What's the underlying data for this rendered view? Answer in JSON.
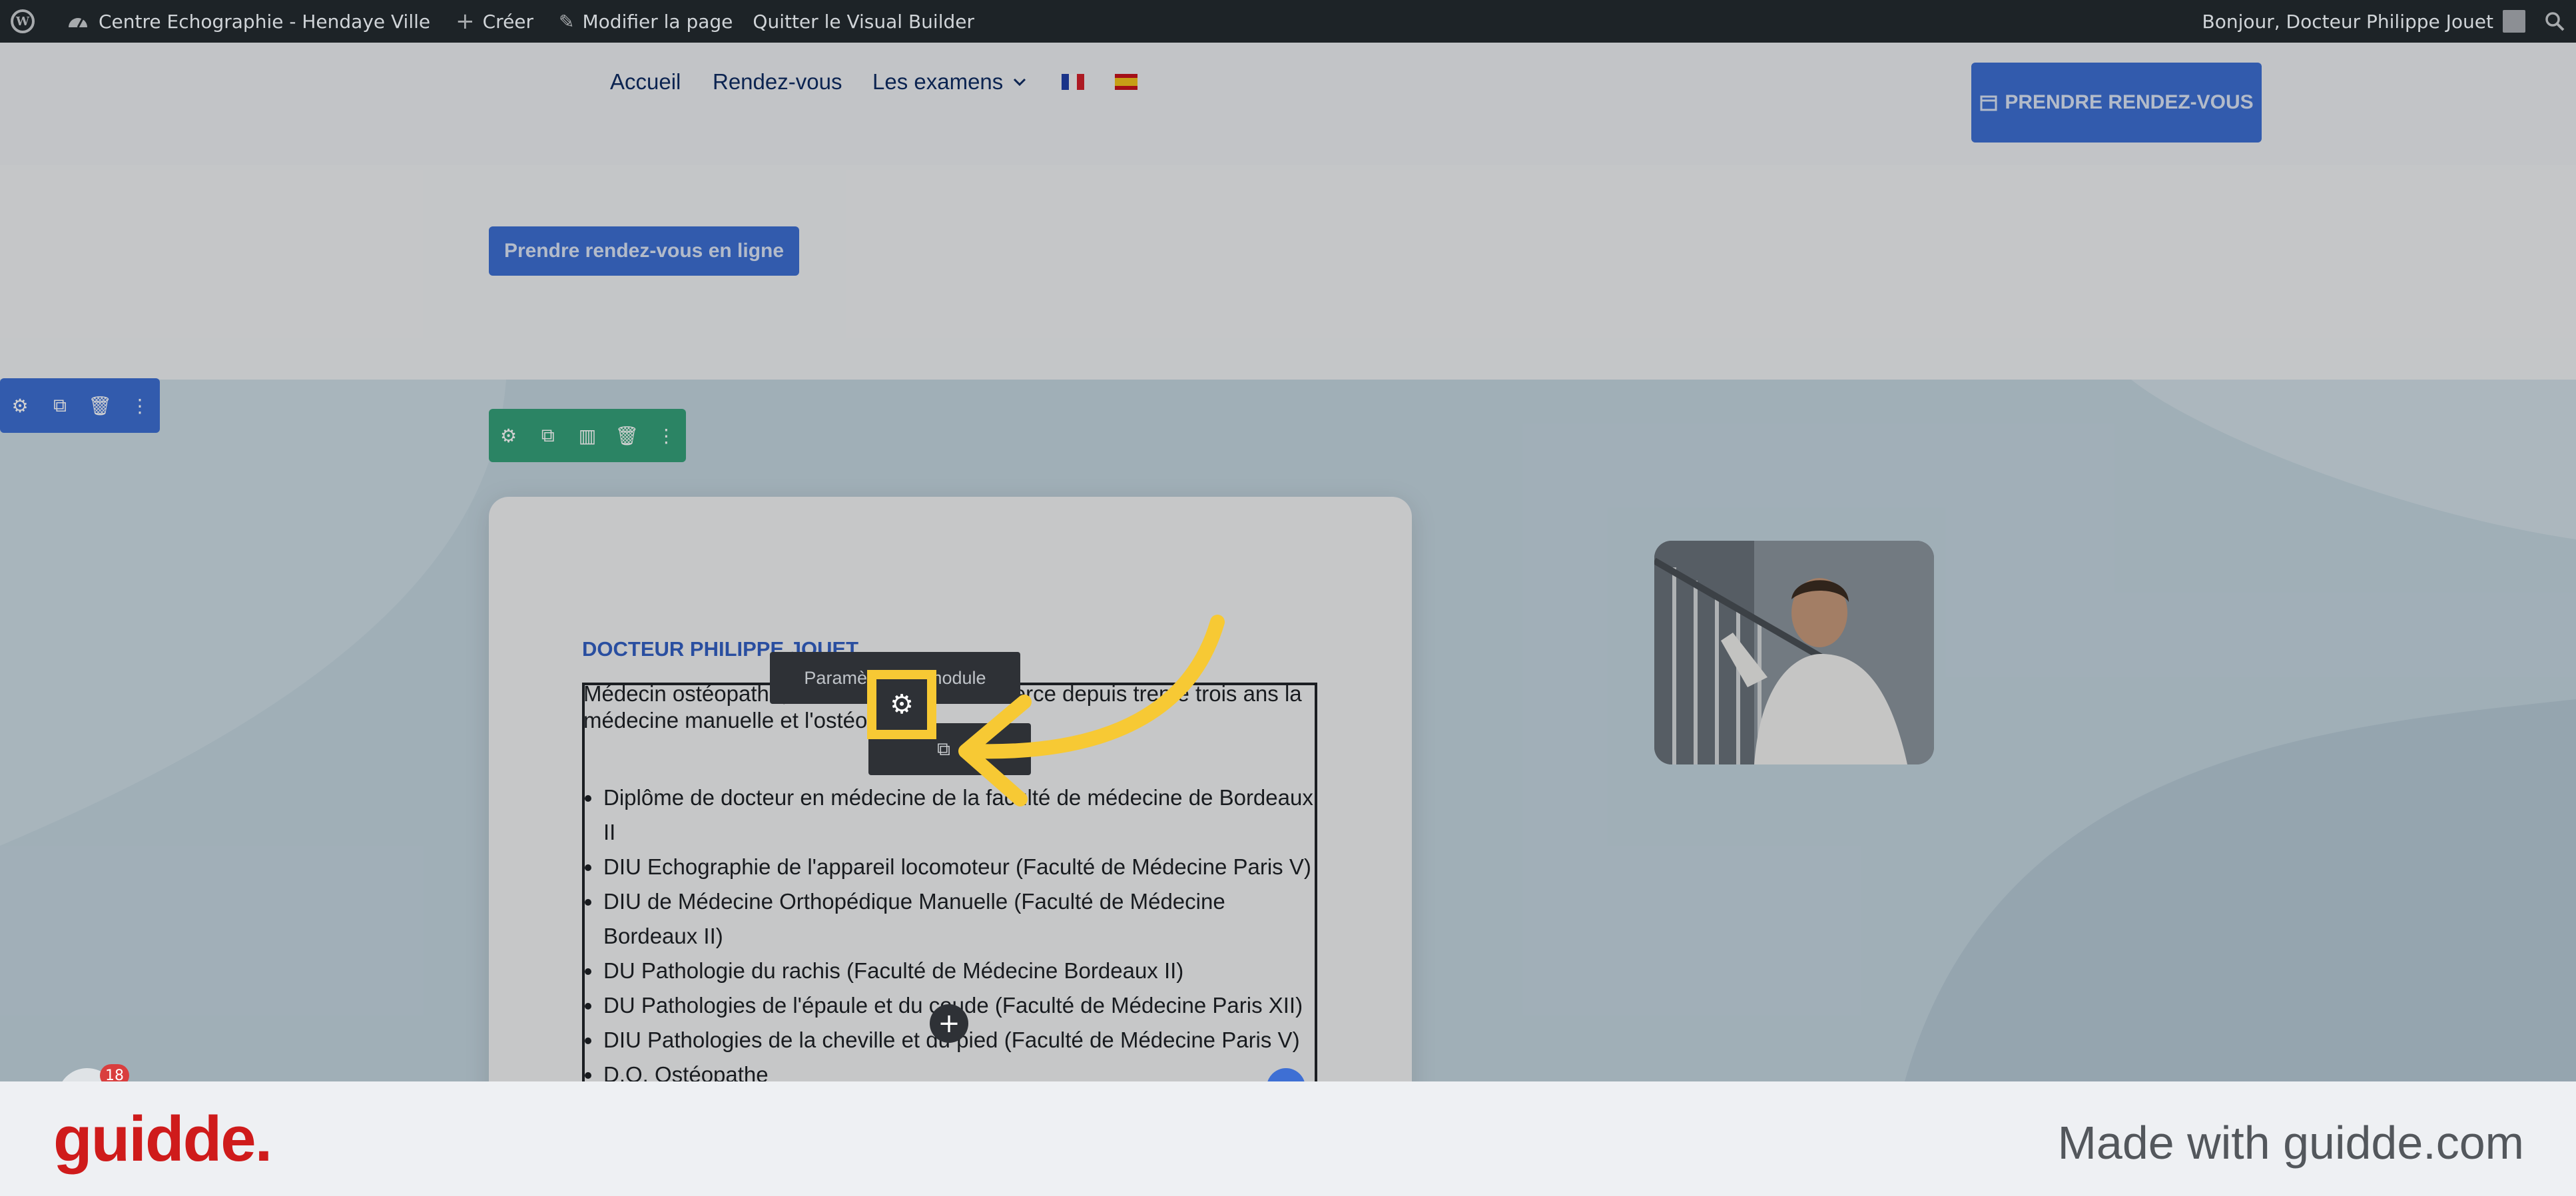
{
  "admin_bar": {
    "site_name": "Centre Echographie - Hendaye Ville",
    "create_label": "Créer",
    "edit_page_label": "Modifier la page",
    "quit_builder_label": "Quitter le Visual Builder",
    "greeting": "Bonjour, Docteur Philippe Jouet"
  },
  "nav": {
    "items": [
      "Accueil",
      "Rendez-vous",
      "Les examens"
    ],
    "cta_label": "PRENDRE RENDEZ-VOUS"
  },
  "online_booking_label": "Prendre rendez-vous en ligne",
  "bio": {
    "title": "DOCTEUR PHILIPPE JOUET",
    "intro": "Médecin ostéopathe, le Dr Philippe Jouet exerce depuis trente trois ans la médecine manuelle et l'ostéopathie.",
    "diplomas": [
      "Diplôme de docteur en médecine de la faculté de médecine de Bordeaux II",
      "DIU Echographie de l'appareil locomoteur (Faculté de Médecine Paris V)",
      "DIU de Médecine Orthopédique Manuelle (Faculté de Médecine Bordeaux II)",
      "DU Pathologie du rachis (Faculté de Médecine Bordeaux II)",
      "DU Pathologies de l'épaule et du coude (Faculté de Médecine Paris XII)",
      "DIU Pathologies de la cheville et du pied (Faculté de Médecine Paris V)",
      "D.O. Ostéopathe"
    ]
  },
  "module_tooltip": "Paramètres du module",
  "notification_count": "18",
  "footer": {
    "logo": "guidde.",
    "made_with": "Made with guidde.com"
  },
  "colors": {
    "admin_bar": "#1d2327",
    "builder_blue": "#3e6fd4",
    "row_green": "#35a27a",
    "highlight_yellow": "#f7c934",
    "brand_red": "#cf1b1b"
  }
}
